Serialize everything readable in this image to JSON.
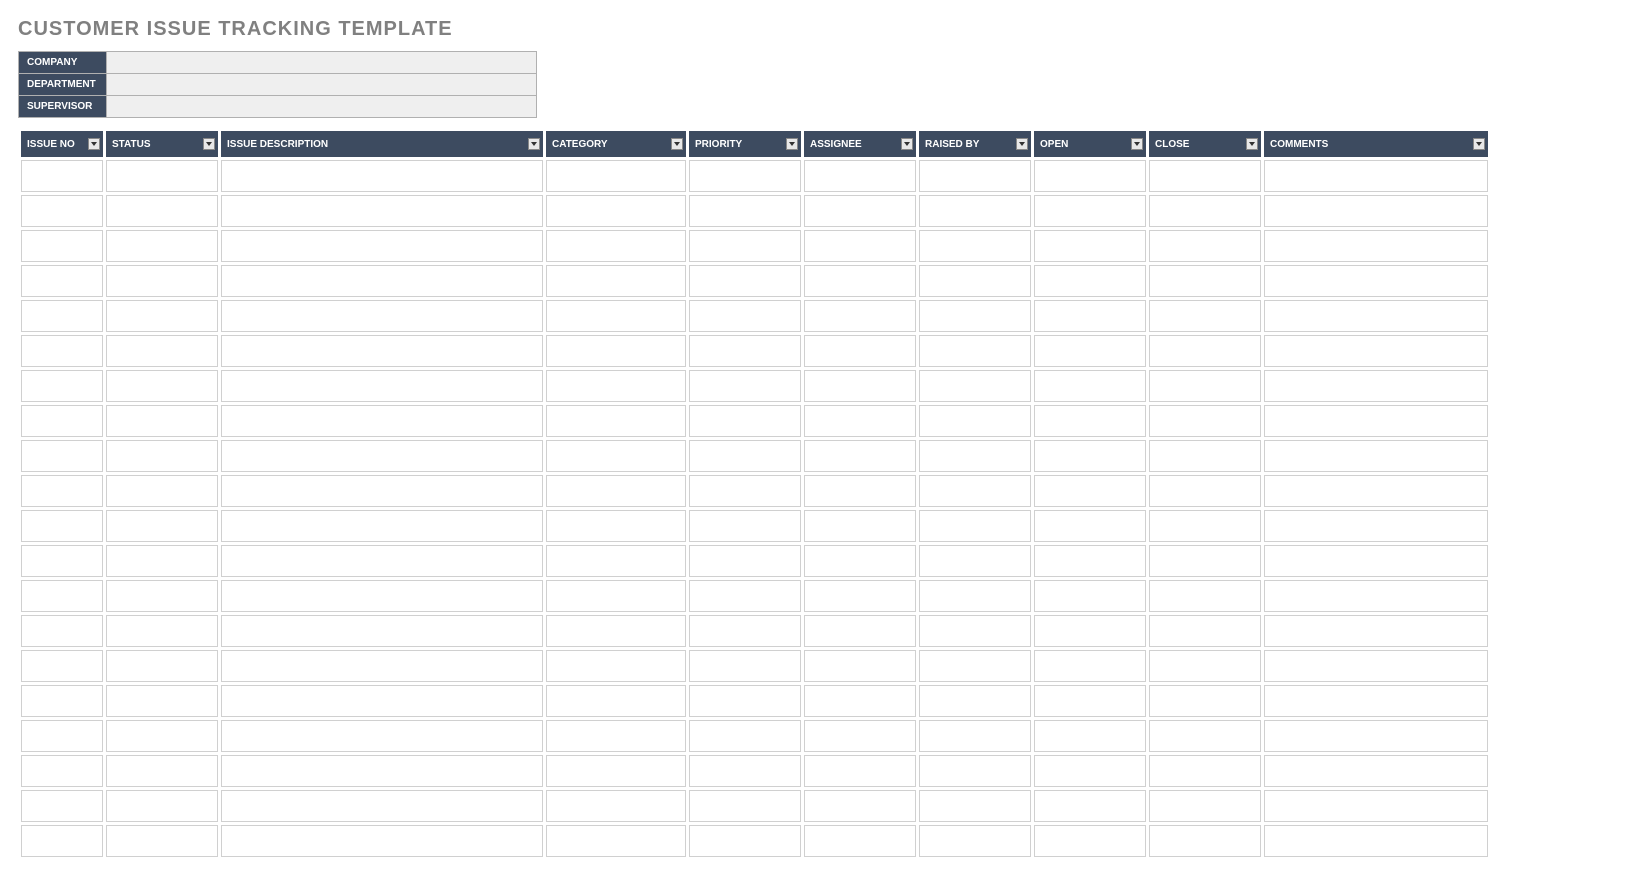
{
  "title": "CUSTOMER ISSUE TRACKING TEMPLATE",
  "meta": {
    "company_label": "COMPANY",
    "company_value": "",
    "department_label": "DEPARTMENT",
    "department_value": "",
    "supervisor_label": "SUPERVISOR",
    "supervisor_value": ""
  },
  "columns": {
    "issue_no": "ISSUE NO",
    "status": "STATUS",
    "description": "ISSUE DESCRIPTION",
    "category": "CATEGORY",
    "priority": "PRIORITY",
    "assignee": "ASSIGNEE",
    "raised_by": "RAISED BY",
    "open": "OPEN",
    "close": "CLOSE",
    "comments": "COMMENTS"
  },
  "row_count": 20
}
